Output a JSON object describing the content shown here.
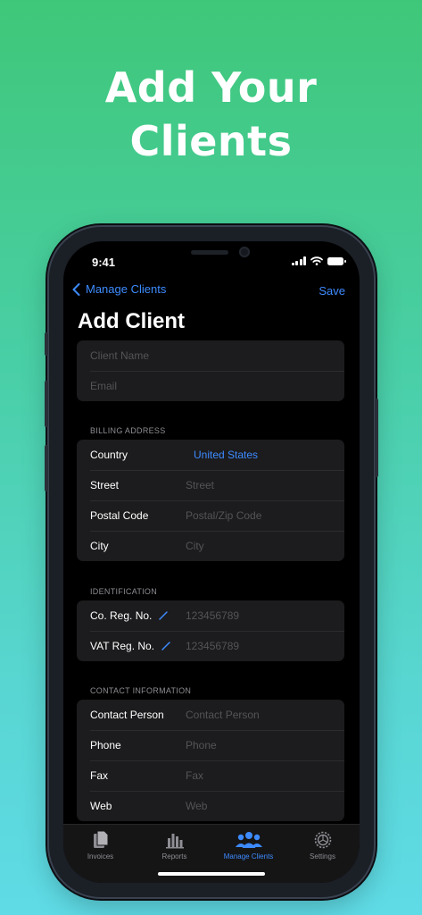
{
  "headline": {
    "line1": "Add Your",
    "line2": "Clients"
  },
  "status": {
    "time": "9:41"
  },
  "nav": {
    "back_label": "Manage Clients",
    "save_label": "Save",
    "title": "Add Client"
  },
  "basic": {
    "client_name_placeholder": "Client Name",
    "email_placeholder": "Email"
  },
  "billing": {
    "header": "BILLING ADDRESS",
    "country_label": "Country",
    "country_value": "United States",
    "street_label": "Street",
    "street_placeholder": "Street",
    "postal_label": "Postal Code",
    "postal_placeholder": "Postal/Zip Code",
    "city_label": "City",
    "city_placeholder": "City"
  },
  "identification": {
    "header": "IDENTIFICATION",
    "co_reg_label": "Co. Reg. No.",
    "co_reg_placeholder": "123456789",
    "vat_reg_label": "VAT Reg. No.",
    "vat_reg_placeholder": "123456789"
  },
  "contact": {
    "header": "CONTACT INFORMATION",
    "person_label": "Contact Person",
    "person_placeholder": "Contact Person",
    "phone_label": "Phone",
    "phone_placeholder": "Phone",
    "fax_label": "Fax",
    "fax_placeholder": "Fax",
    "web_label": "Web",
    "web_placeholder": "Web"
  },
  "tabs": [
    {
      "label": "Invoices",
      "icon": "documents-icon"
    },
    {
      "label": "Reports",
      "icon": "bar-chart-icon"
    },
    {
      "label": "Manage Clients",
      "icon": "people-icon"
    },
    {
      "label": "Settings",
      "icon": "gear-icon"
    }
  ],
  "colors": {
    "accent": "#3d8bff",
    "background_top": "#3fc779",
    "background_bottom": "#5fdbe6"
  }
}
